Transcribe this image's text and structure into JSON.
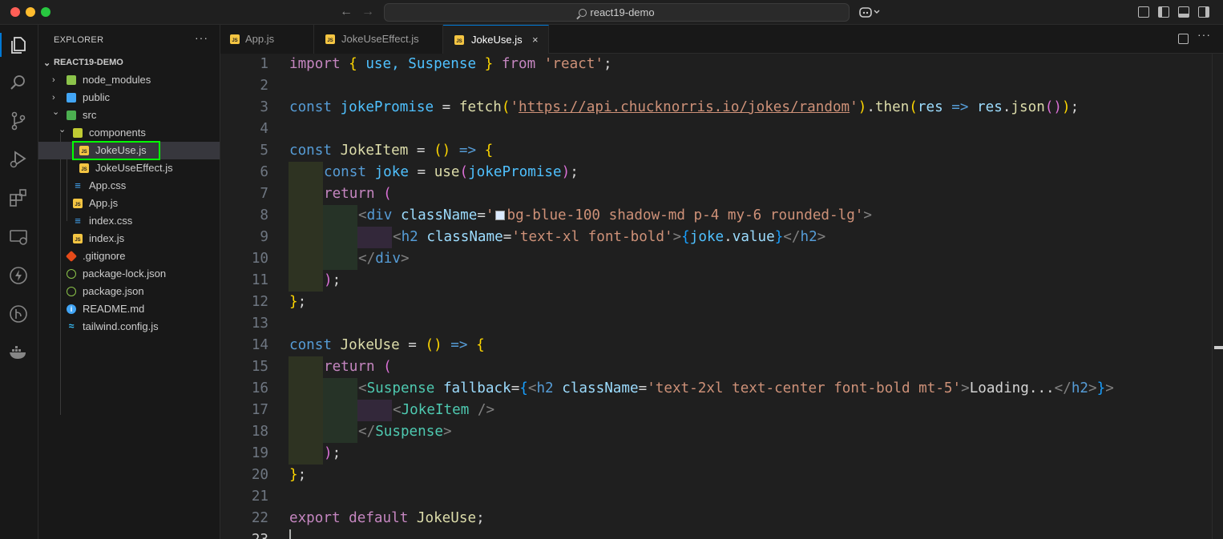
{
  "window": {
    "search_text": "react19-demo"
  },
  "sidebar": {
    "title": "EXPLORER",
    "more": "···",
    "root": "REACT19-DEMO",
    "items": [
      {
        "label": "node_modules",
        "icon": "folder-node-icon"
      },
      {
        "label": "public",
        "icon": "folder-public-icon"
      },
      {
        "label": "src",
        "icon": "folder-src-icon"
      },
      {
        "label": "components",
        "icon": "folder-components-icon"
      },
      {
        "label": "JokeUse.js",
        "icon": "js-file-icon"
      },
      {
        "label": "JokeUseEffect.js",
        "icon": "js-file-icon"
      },
      {
        "label": "App.css",
        "icon": "css-file-icon"
      },
      {
        "label": "App.js",
        "icon": "js-file-icon"
      },
      {
        "label": "index.css",
        "icon": "css-file-icon"
      },
      {
        "label": "index.js",
        "icon": "js-file-icon"
      },
      {
        "label": ".gitignore",
        "icon": "git-file-icon"
      },
      {
        "label": "package-lock.json",
        "icon": "npm-file-icon"
      },
      {
        "label": "package.json",
        "icon": "npm-file-icon"
      },
      {
        "label": "README.md",
        "icon": "info-file-icon"
      },
      {
        "label": "tailwind.config.js",
        "icon": "tailwind-file-icon"
      }
    ]
  },
  "tabs": [
    {
      "label": "App.js"
    },
    {
      "label": "JokeUseEffect.js"
    },
    {
      "label": "JokeUse.js",
      "close": "×"
    }
  ],
  "icons": {
    "js": "JS",
    "css": "≡",
    "info": "i",
    "tailwind": "≈"
  },
  "editor": {
    "line_numbers": [
      "1",
      "2",
      "3",
      "4",
      "5",
      "6",
      "7",
      "8",
      "9",
      "10",
      "11",
      "12",
      "13",
      "14",
      "15",
      "16",
      "17",
      "18",
      "19",
      "20",
      "21",
      "22",
      "23"
    ],
    "lines": {
      "l1": [
        "import",
        " ",
        "{",
        " use, Suspense ",
        "}",
        " from ",
        "'react'",
        ";"
      ],
      "l3": [
        "const",
        " ",
        "jokePromise",
        " = ",
        "fetch",
        "(",
        "'",
        "https://api.chucknorris.io/jokes/random",
        "'",
        ")",
        ".",
        "then",
        "(",
        "res",
        " => ",
        "res",
        ".",
        "json",
        "()",
        ")",
        ";"
      ],
      "l5": [
        "const",
        " ",
        "JokeItem",
        " = ",
        "()",
        " => ",
        "{"
      ],
      "l6": [
        "const",
        " ",
        "joke",
        " = ",
        "use",
        "(",
        "jokePromise",
        ")",
        ";"
      ],
      "l7": [
        "return",
        " ",
        "("
      ],
      "l8": [
        "<",
        "div",
        " ",
        "className",
        "=",
        "'",
        "bg-blue-100 shadow-md p-4 my-6 rounded-lg'",
        ">"
      ],
      "l9": [
        "<",
        "h2",
        " ",
        "className",
        "=",
        "'text-xl font-bold'",
        ">",
        "{",
        "joke",
        ".",
        "value",
        "}",
        "</",
        "h2",
        ">"
      ],
      "l10": [
        "</",
        "div",
        ">"
      ],
      "l11": [
        ")",
        ";"
      ],
      "l12": [
        "}",
        ";"
      ],
      "l14": [
        "const",
        " ",
        "JokeUse",
        " = ",
        "()",
        " => ",
        "{"
      ],
      "l15": [
        "return",
        " ",
        "("
      ],
      "l16": [
        "<",
        "Suspense",
        " ",
        "fallback",
        "=",
        "{",
        "<",
        "h2",
        " ",
        "className",
        "=",
        "'text-2xl text-center font-bold mt-5'",
        ">",
        "Loading...",
        "</",
        "h2",
        ">",
        "}",
        ">"
      ],
      "l17": [
        "<",
        "JokeItem",
        " />"
      ],
      "l18": [
        "</",
        "Suspense",
        ">"
      ],
      "l19": [
        ")",
        ";"
      ],
      "l20": [
        "}",
        ";"
      ],
      "l22": [
        "export",
        " ",
        "default",
        " ",
        "JokeUse",
        ";"
      ]
    }
  }
}
